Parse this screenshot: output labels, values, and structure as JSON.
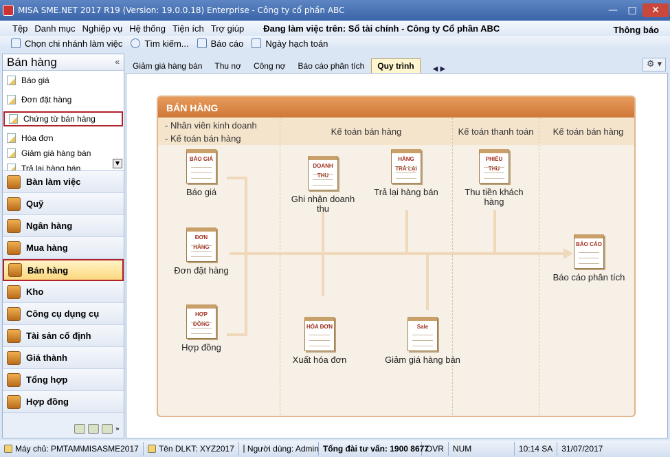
{
  "window": {
    "title": "MISA SME.NET 2017 R19 (Version: 19.0.0.18) Enterprise - Công ty cổ phần ABC"
  },
  "menu": {
    "items": [
      "Tệp",
      "Danh mục",
      "Nghiệp vụ",
      "Hệ thống",
      "Tiện ích",
      "Trợ giúp"
    ],
    "working_on": "Đang làm việc trên: Sổ tài chính - Công ty Cổ phần ABC",
    "notifications": "Thông báo"
  },
  "toolbar": {
    "branch": "Chọn chi nhánh làm việc",
    "search": "Tìm kiếm...",
    "report": "Báo cáo",
    "posting_date": "Ngày hạch toán"
  },
  "sidebar": {
    "title": "Bán hàng",
    "collapse_glyph": "«",
    "subitems": [
      "Báo giá",
      "Đơn đặt hàng",
      "Chứng từ bán hàng",
      "Hóa đơn",
      "Giảm giá hàng bán",
      "Trả lại hàng bán"
    ],
    "modules": [
      "Bàn làm việc",
      "Quỹ",
      "Ngân hàng",
      "Mua hàng",
      "Bán hàng",
      "Kho",
      "Công cụ dụng cụ",
      "Tài sản cố định",
      "Giá thành",
      "Tổng hợp",
      "Hợp đồng"
    ]
  },
  "tabs": [
    "Giảm giá hàng bán",
    "Thu nợ",
    "Công nợ",
    "Báo cáo phân tích",
    "Quy trình"
  ],
  "tab_nav": "◀ ▶",
  "flow": {
    "title": "BÁN HÀNG",
    "col_roles_left": [
      "- Nhân viên kinh doanh",
      "- Kế toán bán hàng"
    ],
    "col_labels": [
      "Kế toán bán hàng",
      "Kế toán thanh toán",
      "Kế toán bán hàng"
    ],
    "nodes": {
      "bao_gia": {
        "label": "Báo giá",
        "icon_text": "BÁO GIÁ"
      },
      "don_dat_hang": {
        "label": "Đơn đặt hàng",
        "icon_text": "ĐƠN HÀNG"
      },
      "hop_dong": {
        "label": "Hợp đồng",
        "icon_text": "HỢP ĐỒNG"
      },
      "ghi_nhan": {
        "label": "Ghi nhận doanh thu",
        "icon_text": "DOANH THU"
      },
      "tra_lai": {
        "label": "Trả lại hàng bán",
        "icon_text": "HÀNG TRẢ LẠI"
      },
      "thu_tien": {
        "label": "Thu tiền khách hàng",
        "icon_text": "PHIẾU THU"
      },
      "bao_cao": {
        "label": "Báo cáo phân tích",
        "icon_text": "BÁO CÁO"
      },
      "xuat_hd": {
        "label": "Xuất hóa đơn",
        "icon_text": "HÓA ĐƠN"
      },
      "giam_gia": {
        "label": "Giảm giá hàng bán",
        "icon_text": "Sale"
      }
    }
  },
  "status": {
    "server": "Máy chủ: PMTAM\\MISASME2017",
    "db": "Tên DLKT: XYZ2017",
    "user": "Người dùng: Admin",
    "hotline": "Tổng đài tư vấn: 1900 8677",
    "ovr": "OVR",
    "num": "NUM",
    "time": "10:14 SA",
    "date": "31/07/2017"
  },
  "colors": {
    "accent": "#cf7737",
    "selection_border": "#b0202a"
  }
}
